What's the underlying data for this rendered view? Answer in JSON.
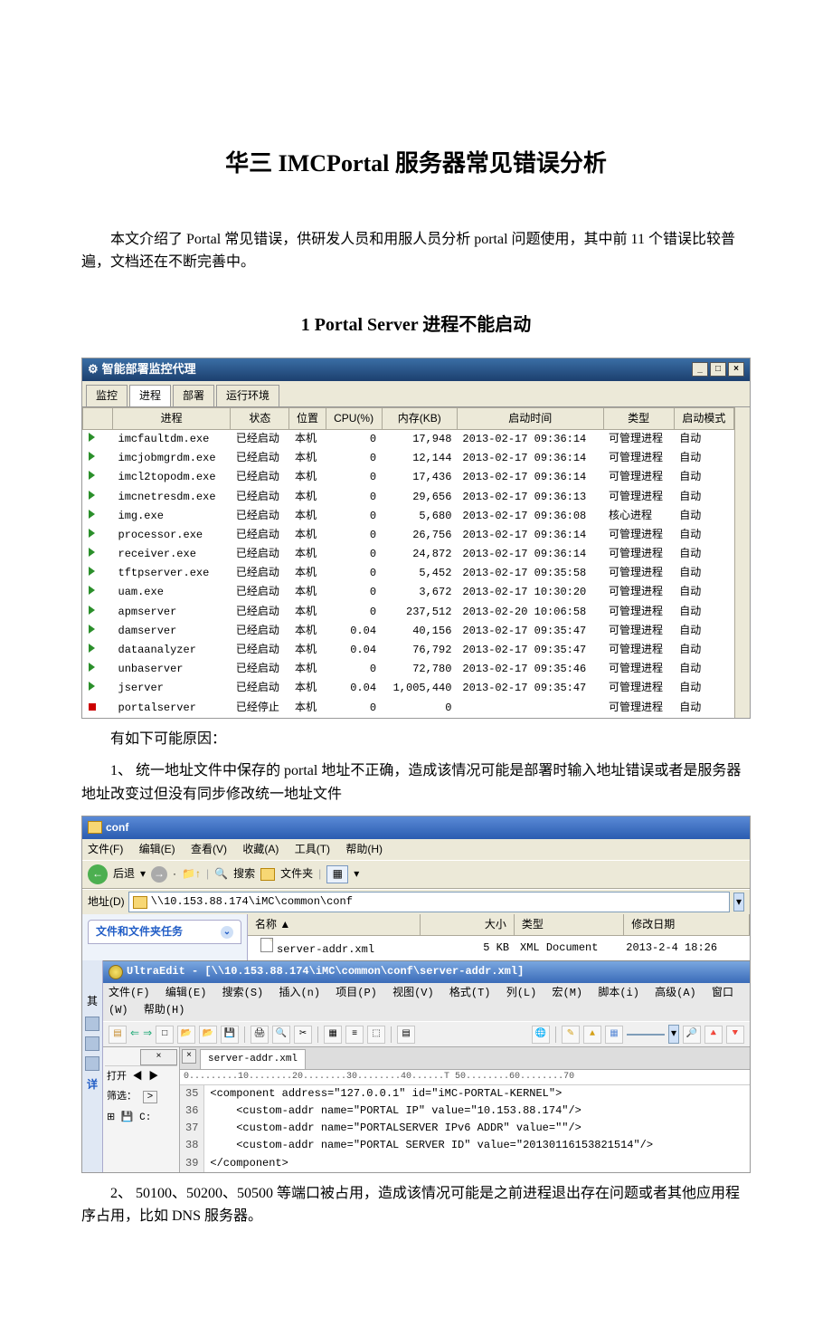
{
  "doc": {
    "title": "华三 IMCPortal 服务器常见错误分析",
    "intro": "本文介绍了 Portal 常见错误，供研发人员和用服人员分析 portal 问题使用，其中前 11 个错误比较普遍，文档还在不断完善中。",
    "section1_title": "1 Portal Server 进程不能启动",
    "cause_intro": "有如下可能原因：",
    "cause1": "1、 统一地址文件中保存的 portal 地址不正确，造成该情况可能是部署时输入地址错误或者是服务器地址改变过但没有同步修改统一地址文件",
    "cause2": "2、 50100、50200、50500 等端口被占用，造成该情况可能是之前进程退出存在问题或者其他应用程序占用，比如 DNS 服务器。"
  },
  "pm": {
    "title": "智能部署监控代理",
    "tabs": [
      "监控",
      "进程",
      "部署",
      "运行环境"
    ],
    "cols": [
      "进程",
      "状态",
      "位置",
      "CPU(%)",
      "内存(KB)",
      "启动时间",
      "类型",
      "启动模式"
    ],
    "rows": [
      {
        "name": "imcfaultdm.exe",
        "state": "已经启动",
        "loc": "本机",
        "cpu": "0",
        "mem": "17,948",
        "start": "2013-02-17 09:36:14",
        "type": "可管理进程",
        "mode": "自动",
        "run": true
      },
      {
        "name": "imcjobmgrdm.exe",
        "state": "已经启动",
        "loc": "本机",
        "cpu": "0",
        "mem": "12,144",
        "start": "2013-02-17 09:36:14",
        "type": "可管理进程",
        "mode": "自动",
        "run": true
      },
      {
        "name": "imcl2topodm.exe",
        "state": "已经启动",
        "loc": "本机",
        "cpu": "0",
        "mem": "17,436",
        "start": "2013-02-17 09:36:14",
        "type": "可管理进程",
        "mode": "自动",
        "run": true
      },
      {
        "name": "imcnetresdm.exe",
        "state": "已经启动",
        "loc": "本机",
        "cpu": "0",
        "mem": "29,656",
        "start": "2013-02-17 09:36:13",
        "type": "可管理进程",
        "mode": "自动",
        "run": true
      },
      {
        "name": "img.exe",
        "state": "已经启动",
        "loc": "本机",
        "cpu": "0",
        "mem": "5,680",
        "start": "2013-02-17 09:36:08",
        "type": "核心进程",
        "mode": "自动",
        "run": true
      },
      {
        "name": "processor.exe",
        "state": "已经启动",
        "loc": "本机",
        "cpu": "0",
        "mem": "26,756",
        "start": "2013-02-17 09:36:14",
        "type": "可管理进程",
        "mode": "自动",
        "run": true
      },
      {
        "name": "receiver.exe",
        "state": "已经启动",
        "loc": "本机",
        "cpu": "0",
        "mem": "24,872",
        "start": "2013-02-17 09:36:14",
        "type": "可管理进程",
        "mode": "自动",
        "run": true
      },
      {
        "name": "tftpserver.exe",
        "state": "已经启动",
        "loc": "本机",
        "cpu": "0",
        "mem": "5,452",
        "start": "2013-02-17 09:35:58",
        "type": "可管理进程",
        "mode": "自动",
        "run": true
      },
      {
        "name": "uam.exe",
        "state": "已经启动",
        "loc": "本机",
        "cpu": "0",
        "mem": "3,672",
        "start": "2013-02-17 10:30:20",
        "type": "可管理进程",
        "mode": "自动",
        "run": true
      },
      {
        "name": "apmserver",
        "state": "已经启动",
        "loc": "本机",
        "cpu": "0",
        "mem": "237,512",
        "start": "2013-02-20 10:06:58",
        "type": "可管理进程",
        "mode": "自动",
        "run": true
      },
      {
        "name": "damserver",
        "state": "已经启动",
        "loc": "本机",
        "cpu": "0.04",
        "mem": "40,156",
        "start": "2013-02-17 09:35:47",
        "type": "可管理进程",
        "mode": "自动",
        "run": true
      },
      {
        "name": "dataanalyzer",
        "state": "已经启动",
        "loc": "本机",
        "cpu": "0.04",
        "mem": "76,792",
        "start": "2013-02-17 09:35:47",
        "type": "可管理进程",
        "mode": "自动",
        "run": true
      },
      {
        "name": "unbaserver",
        "state": "已经启动",
        "loc": "本机",
        "cpu": "0",
        "mem": "72,780",
        "start": "2013-02-17 09:35:46",
        "type": "可管理进程",
        "mode": "自动",
        "run": true
      },
      {
        "name": "jserver",
        "state": "已经启动",
        "loc": "本机",
        "cpu": "0.04",
        "mem": "1,005,440",
        "start": "2013-02-17 09:35:47",
        "type": "可管理进程",
        "mode": "自动",
        "run": true
      },
      {
        "name": "portalserver",
        "state": "已经停止",
        "loc": "本机",
        "cpu": "0",
        "mem": "0",
        "start": "",
        "type": "可管理进程",
        "mode": "自动",
        "run": false
      }
    ]
  },
  "exp": {
    "title": "conf",
    "menu": [
      "文件(F)",
      "编辑(E)",
      "查看(V)",
      "收藏(A)",
      "工具(T)",
      "帮助(H)"
    ],
    "back": "后退",
    "search": "搜索",
    "folders": "文件夹",
    "addr_label": "地址(D)",
    "addr": "\\\\10.153.88.174\\iMC\\common\\conf",
    "task_title": "文件和文件夹任务",
    "cols": {
      "name": "名称 ▲",
      "size": "大小",
      "type": "类型",
      "date": "修改日期"
    },
    "file": {
      "name": "server-addr.xml",
      "size": "5 KB",
      "type": "XML Document",
      "date": "2013-2-4 18:26"
    },
    "left_labels": {
      "other": "其",
      "open": "打开",
      "filter": "筛选：",
      "fwd": ">",
      "drive": "C:",
      "details": "详"
    }
  },
  "ue": {
    "title": "UltraEdit - [\\\\10.153.88.174\\iMC\\common\\conf\\server-addr.xml]",
    "menu": [
      "文件(F)",
      "编辑(E)",
      "搜索(S)",
      "插入(n)",
      "项目(P)",
      "视图(V)",
      "格式(T)",
      "列(L)",
      "宏(M)",
      "脚本(i)",
      "高级(A)",
      "窗口(W)",
      "帮助(H)"
    ],
    "tab": "server-addr.xml",
    "ruler": "0.........10........20........30........40......T 50........60........70",
    "gutter": [
      "35",
      "36",
      "37",
      "38",
      "39"
    ],
    "code_lines": [
      "<component address=\"127.0.0.1\" id=\"iMC-PORTAL-KERNEL\">",
      "    <custom-addr name=\"PORTAL IP\" value=\"10.153.88.174\"/>",
      "    <custom-addr name=\"PORTALSERVER IPv6 ADDR\" value=\"\"/>",
      "    <custom-addr name=\"PORTAL SERVER ID\" value=\"20130116153821514\"/>",
      "</component>"
    ]
  }
}
